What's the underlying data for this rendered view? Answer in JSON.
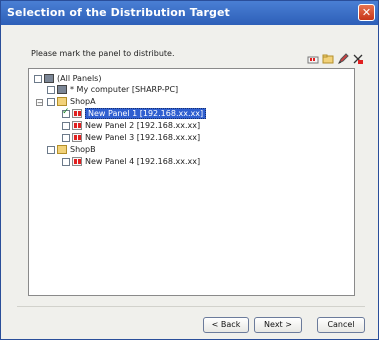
{
  "window": {
    "title": "Selection of the Distribution Target",
    "close_icon": "close-icon"
  },
  "instruction": "Please mark the panel to distribute.",
  "toolbar": {
    "icons": [
      "add-panel-icon",
      "add-folder-icon",
      "edit-icon",
      "delete-icon"
    ]
  },
  "tree": {
    "items": [
      {
        "label": "(All Panels)",
        "icon": "all-panels-icon",
        "checked": false
      },
      {
        "label": "* My computer [SHARP-PC]",
        "icon": "computer-icon",
        "checked": false
      },
      {
        "label": "ShopA",
        "icon": "folder-icon",
        "checked": false
      },
      {
        "label": "New Panel 1 [192.168.xx.xx]",
        "icon": "panel-icon",
        "checked": true,
        "selected": true
      },
      {
        "label": "New Panel 2 [192.168.xx.xx]",
        "icon": "panel-icon",
        "checked": false
      },
      {
        "label": "New Panel 3 [192.168.xx.xx]",
        "icon": "panel-icon",
        "checked": false
      },
      {
        "label": "ShopB",
        "icon": "folder-icon",
        "checked": false
      },
      {
        "label": "New Panel 4 [192.168.xx.xx]",
        "icon": "panel-icon",
        "checked": false
      }
    ]
  },
  "buttons": {
    "back": "< Back",
    "next": "Next >",
    "cancel": "Cancel"
  }
}
